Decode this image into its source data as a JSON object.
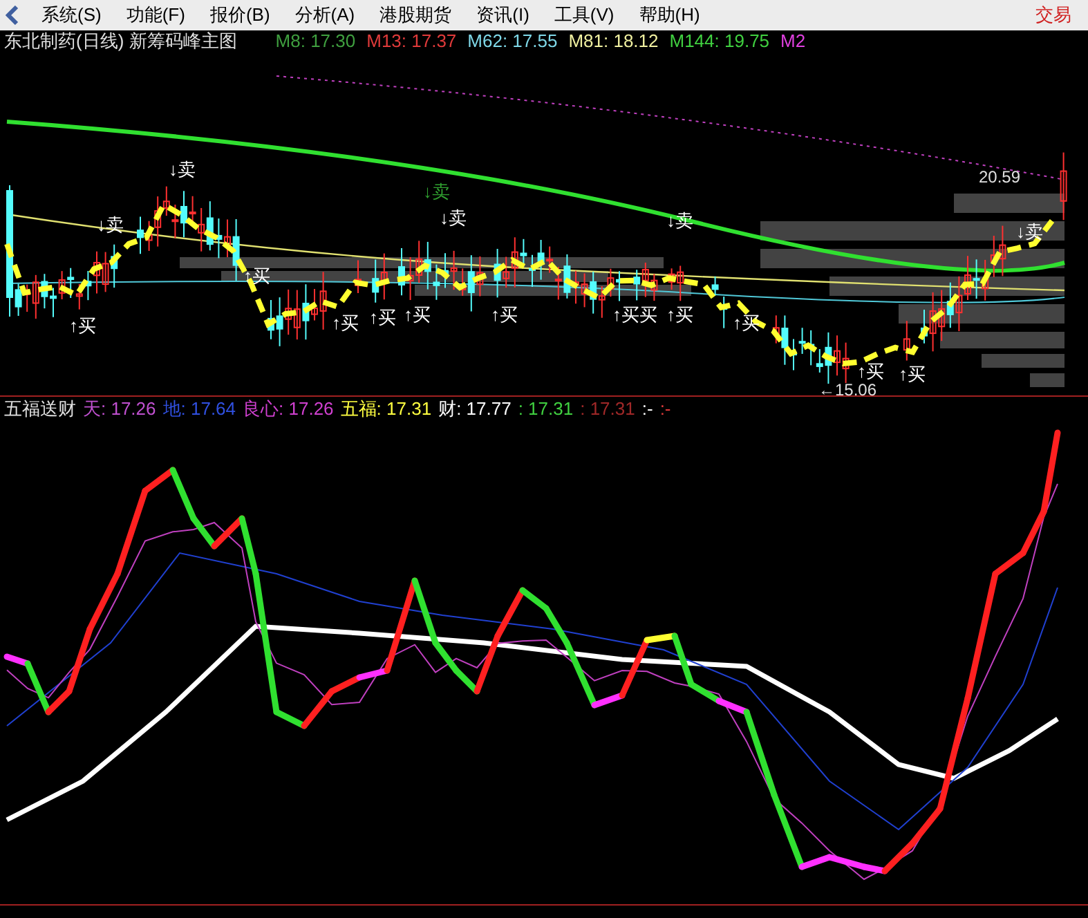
{
  "menu": {
    "items": [
      "系统(S)",
      "功能(F)",
      "报价(B)",
      "分析(A)",
      "港股期货",
      "资讯(I)",
      "工具(V)",
      "帮助(H)"
    ],
    "trade": "交易"
  },
  "main_chart": {
    "title": "东北制药(日线) 新筹码峰主图",
    "legend": [
      {
        "label": "M8: 17.30",
        "color": "#3f9f3f"
      },
      {
        "label": "M13: 17.37",
        "color": "#e03a3a"
      },
      {
        "label": "M62: 17.55",
        "color": "#7fd8e8"
      },
      {
        "label": "M81: 18.12",
        "color": "#f0f0a0"
      },
      {
        "label": "M144: 19.75",
        "color": "#40d040"
      },
      {
        "label": "M2",
        "color": "#e040e0"
      }
    ],
    "signals": [
      {
        "text": "↓卖",
        "kind": "sell"
      },
      {
        "text": "↓卖",
        "kind": "sell"
      },
      {
        "text": "↓卖",
        "kind": "sell_faint"
      },
      {
        "text": "↓卖",
        "kind": "sell"
      },
      {
        "text": "↓卖",
        "kind": "sell"
      },
      {
        "text": "↓卖",
        "kind": "sell"
      },
      {
        "text": "↑买",
        "kind": "buy"
      },
      {
        "text": "↑买",
        "kind": "buy"
      },
      {
        "text": "↑买",
        "kind": "buy"
      },
      {
        "text": "↑买",
        "kind": "buy"
      },
      {
        "text": "↑买",
        "kind": "buy"
      },
      {
        "text": "↑买",
        "kind": "buy"
      },
      {
        "text": "↑买买",
        "kind": "buy"
      },
      {
        "text": "↑买",
        "kind": "buy"
      },
      {
        "text": "↑买",
        "kind": "buy"
      },
      {
        "text": "↑买",
        "kind": "buy"
      },
      {
        "text": "↑买",
        "kind": "buy"
      }
    ],
    "price_labels": [
      "20.59",
      "←15.06"
    ]
  },
  "indicator_chart": {
    "title": "五福送财",
    "legend": [
      {
        "label": "天",
        "value": ": 17.26",
        "color": "#c050d0"
      },
      {
        "label": "地",
        "value": ": 17.64",
        "color": "#3050e0"
      },
      {
        "label": "良心",
        "value": ": 17.26",
        "color": "#d040d0"
      },
      {
        "label": "五福",
        "value": ": 17.31",
        "color": "#ffff40"
      },
      {
        "label": "财",
        "value": ": 17.77",
        "color": "#ffffff"
      },
      {
        "value": ": 17.31",
        "color": "#40d040"
      },
      {
        "value": ": 17.31",
        "color": "#a02828"
      },
      {
        "value": ":-",
        "color": "#ffffff"
      },
      {
        "value": ":-",
        "color": "#e03a3a"
      }
    ]
  }
}
